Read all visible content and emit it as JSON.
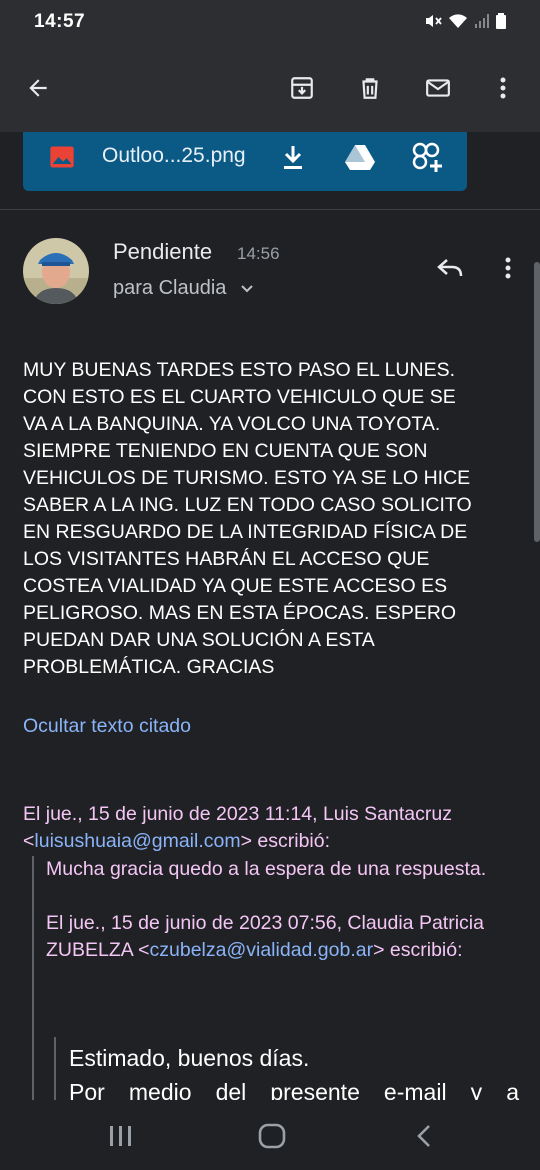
{
  "status_bar": {
    "time": "14:57"
  },
  "toolbar": {
    "back": "back-arrow-icon",
    "archive": "archive-icon",
    "delete": "trash-icon",
    "mark_unread": "mail-icon",
    "more": "more-vert-icon"
  },
  "attachment": {
    "file_name": "Outloo...25.png",
    "icon": "image-icon",
    "actions": [
      "download-icon",
      "drive-icon",
      "photos-add-icon"
    ]
  },
  "message": {
    "sender": "Pendiente",
    "time": "14:56",
    "recipient": "para Claudia",
    "body": "MUY BUENAS TARDES ESTO PASO EL LUNES.\nCON ESTO ES EL CUARTO VEHICULO QUE SE\nVA A LA BANQUINA. YA VOLCO UNA TOYOTA.\nSIEMPRE TENIENDO EN CUENTA QUE SON\nVEHICULOS DE TURISMO. ESTO YA SE LO HICE\nSABER A LA ING. LUZ EN TODO CASO SOLICITO\nEN RESGUARDO DE LA INTEGRIDAD FÍSICA DE\nLOS VISITANTES HABRÁN EL ACCESO QUE\nCOSTEA VIALIDAD YA QUE ESTE ACCESO ES\nPELIGROSO. MAS EN ESTA ÉPOCAS. ESPERO\nPUEDAN DAR UNA SOLUCIÓN A ESTA\nPROBLEMÁTICA. GRACIAS",
    "hide_quoted": "Ocultar texto citado"
  },
  "quoted": {
    "header1_pre": "El jue., 15 de junio de 2023 11:14, Luis Santacruz <",
    "header1_email": "luisushuaia@gmail.com",
    "header1_post": "> escribió:",
    "text1": "Mucha gracia quedo a la espera de una respuesta.",
    "header2_pre": "El jue., 15 de junio de 2023 07:56, Claudia Patricia ZUBELZA <",
    "header2_email": "czubelza@vialidad.gob.ar",
    "header2_post": "> escribió:",
    "deep_line1": "Estimado, buenos días.",
    "deep_line2": "Por medio del presente e-mail y a"
  },
  "colors": {
    "background": "#202124",
    "attachment_card": "#0b5a86",
    "link": "#8ab4f8",
    "quoted_text": "#f4c6f5"
  }
}
